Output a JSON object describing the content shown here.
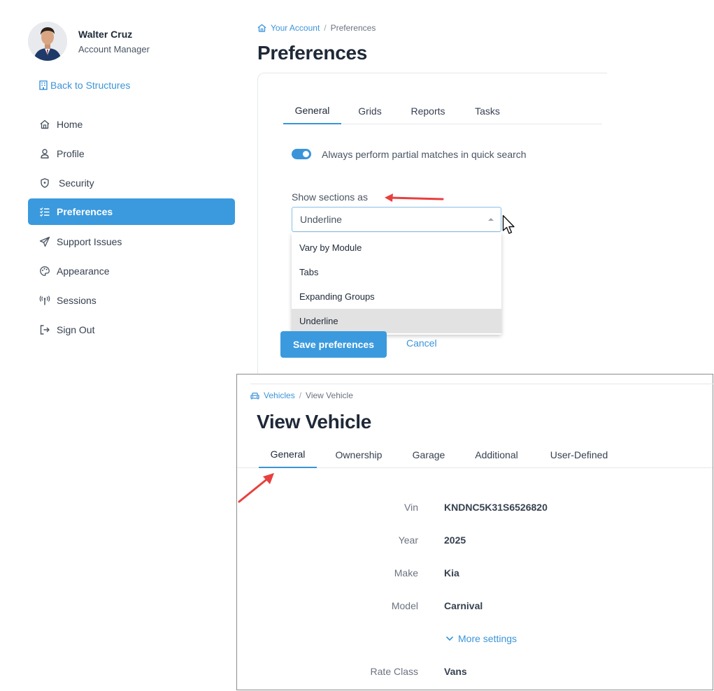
{
  "user": {
    "name": "Walter Cruz",
    "role": "Account Manager"
  },
  "sidebar": {
    "back_label": "Back to Structures",
    "items": [
      {
        "label": "Home",
        "icon": "home-icon"
      },
      {
        "label": "Profile",
        "icon": "user-icon"
      },
      {
        "label": "Security",
        "icon": "shield-icon"
      },
      {
        "label": "Preferences",
        "icon": "checklist-icon",
        "active": true
      },
      {
        "label": "Support Issues",
        "icon": "paper-plane-icon"
      },
      {
        "label": "Appearance",
        "icon": "palette-icon"
      },
      {
        "label": "Sessions",
        "icon": "antenna-icon"
      },
      {
        "label": "Sign Out",
        "icon": "sign-out-icon"
      }
    ]
  },
  "preferences": {
    "breadcrumb": {
      "root": "Your Account",
      "current": "Preferences"
    },
    "title": "Preferences",
    "tabs": [
      "General",
      "Grids",
      "Reports",
      "Tasks"
    ],
    "active_tab": "General",
    "toggle_label": "Always perform partial matches in quick search",
    "toggle_on": true,
    "sections_label": "Show sections as",
    "select_value": "Underline",
    "options": [
      "Vary by Module",
      "Tabs",
      "Expanding Groups",
      "Underline"
    ],
    "save_label": "Save preferences",
    "cancel_label": "Cancel"
  },
  "vehicle": {
    "breadcrumb": {
      "root": "Vehicles",
      "current": "View Vehicle"
    },
    "title": "View Vehicle",
    "tabs": [
      "General",
      "Ownership",
      "Garage",
      "Additional",
      "User-Defined"
    ],
    "active_tab": "General",
    "fields": [
      {
        "label": "Vin",
        "value": "KNDNC5K31S6526820"
      },
      {
        "label": "Year",
        "value": "2025"
      },
      {
        "label": "Make",
        "value": "Kia"
      },
      {
        "label": "Model",
        "value": "Carnival"
      }
    ],
    "more_settings_label": "More settings",
    "rate_class": {
      "label": "Rate Class",
      "value": "Vans"
    }
  },
  "colors": {
    "accent": "#3b94d9",
    "active_nav": "#3b9ade",
    "annotation_arrow": "#e8403f"
  }
}
